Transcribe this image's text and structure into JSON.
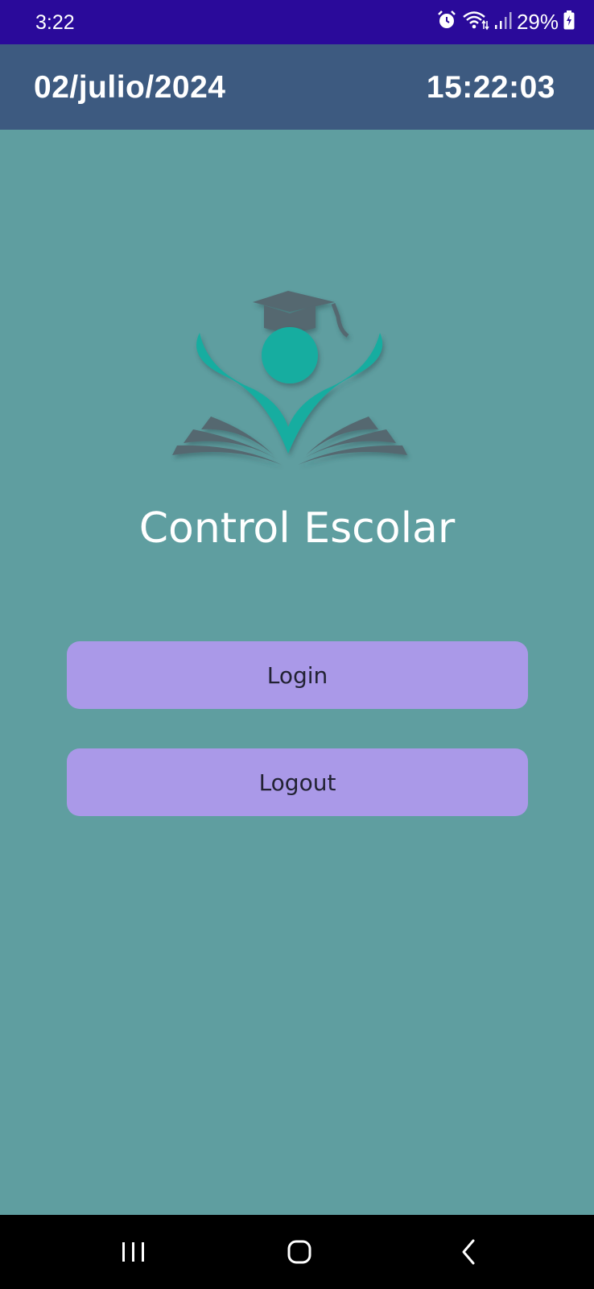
{
  "status_bar": {
    "time": "3:22",
    "battery": "29%",
    "icons": [
      "alarm-icon",
      "wifi-icon",
      "signal-icon",
      "battery-charging-icon"
    ]
  },
  "header": {
    "date": "02/julio/2024",
    "clock": "15:22:03"
  },
  "main": {
    "logo_icon": "graduate-book-logo",
    "title": "Control Escolar",
    "buttons": {
      "login": "Login",
      "logout": "Logout"
    }
  },
  "nav_bar": {
    "icons": [
      "recent-apps-icon",
      "home-icon",
      "back-icon"
    ]
  },
  "colors": {
    "status_bar": "#2a0a9a",
    "header": "#3d5a80",
    "background": "#5f9ea0",
    "button": "#aa99e8",
    "logo_teal": "#14ada0",
    "logo_gray": "#546870"
  }
}
